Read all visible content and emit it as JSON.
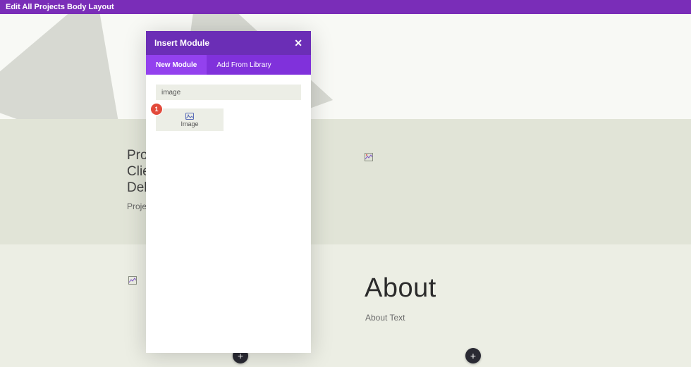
{
  "topbar": {
    "title": "Edit All Projects Body Layout"
  },
  "project": {
    "line1": "Proj",
    "line2": "Clie",
    "line3": "Deli",
    "sub": "Projec"
  },
  "about": {
    "title": "About",
    "text": "About Text"
  },
  "modal": {
    "title": "Insert Module",
    "tab_new": "New Module",
    "tab_lib": "Add From Library",
    "search_value": "image",
    "module_label": "Image",
    "badge": "1"
  },
  "icons": {
    "close": "✕",
    "plus": "+"
  }
}
